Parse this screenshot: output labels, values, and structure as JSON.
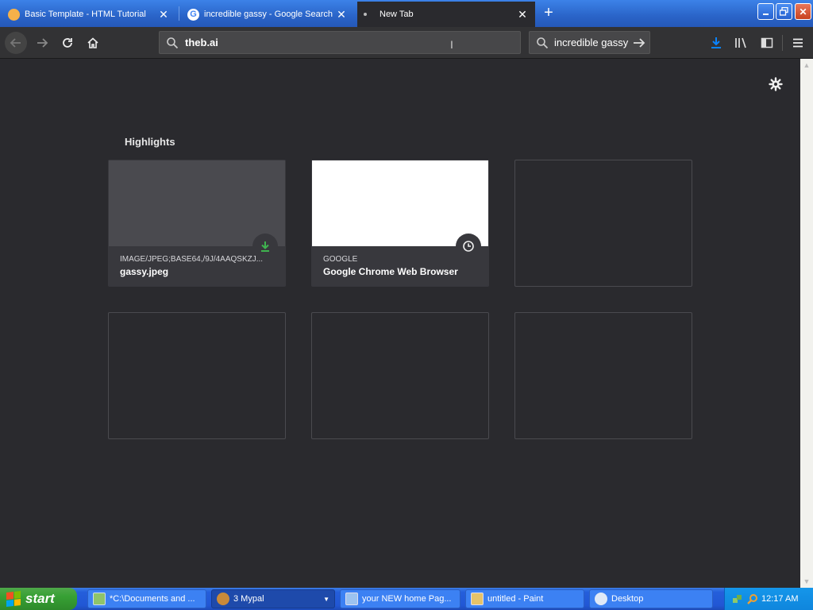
{
  "tabs": [
    {
      "title": "Basic Template - HTML Tutorial",
      "favicon": "orange-circle-icon",
      "active": false
    },
    {
      "title": "incredible gassy - Google Search",
      "favicon": "google-g-icon",
      "active": false
    },
    {
      "title": "New Tab",
      "favicon": "dot-icon",
      "active": true
    }
  ],
  "window_controls": {
    "minimize": "minimize-icon",
    "maximize": "restore-icon",
    "close": "close-icon"
  },
  "navbar": {
    "url": "theb.ai",
    "search_value": "incredible gassy"
  },
  "content": {
    "highlights_title": "Highlights",
    "cards": [
      {
        "context": "IMAGE/JPEG;BASE64,/9J/4AAQSKZJ...",
        "title": "gassy.jpeg",
        "badge": "download-icon"
      },
      {
        "context": "GOOGLE",
        "title": "Google Chrome Web Browser",
        "badge": "clock-icon"
      }
    ]
  },
  "taskbar": {
    "start_label": "start",
    "tasks": [
      {
        "label": "*C:\\Documents and ...",
        "icon": "notepad-icon"
      },
      {
        "label": "3 Mypal",
        "icon": "mypal-icon",
        "active": true
      },
      {
        "label": "your NEW home Pag...",
        "icon": "ie-icon"
      },
      {
        "label": "untitled - Paint",
        "icon": "paint-icon"
      },
      {
        "label": "Desktop",
        "icon": "desktop-icon"
      }
    ],
    "clock": "12:17 AM"
  },
  "colors": {
    "tabstrip": "#2a64c8",
    "content_bg": "#2a2a2e",
    "download_green": "#3fb34f",
    "accent_blue": "#0a84ff"
  }
}
